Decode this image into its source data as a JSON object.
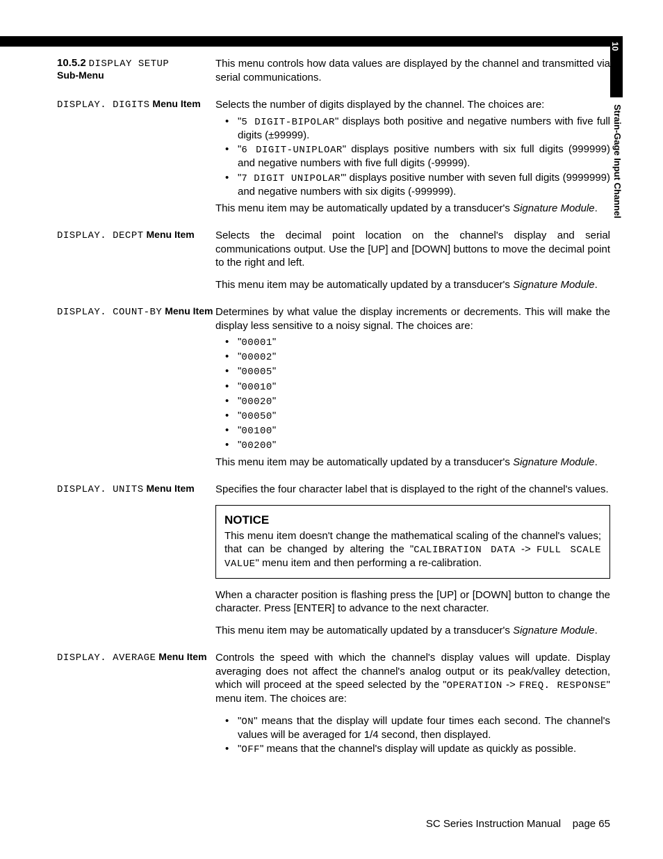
{
  "sidebar": {
    "chapter_num": "10",
    "chapter_title": "Strain-Gage Input Channel"
  },
  "section": {
    "num": "10.5.2",
    "title_lcd": "DISPLAY SETUP",
    "title_rest": "Sub-Menu",
    "intro": "This menu controls how data values are displayed by the channel and transmitted via serial communications."
  },
  "digits": {
    "label_prefix": "DISPLAY. DIGITS",
    "label_suffix": " Menu Item",
    "intro": "Selects the number of digits displayed by the channel. The choices are:",
    "b1a": "5 DIGIT-BIPOLAR",
    "b1b": "\" displays both positive and negative numbers with five full digits (±99999).",
    "b2a": "6 DIGIT-UNIPLOAR",
    "b2b": "\" displays positive numbers with six full digits (999999) and negative numbers with five full digits (-99999).",
    "b3a": "7 DIGIT UNIPOLAR",
    "b3b": "'\" displays positive number with seven full digits (9999999) and negative numbers with six digits (-999999).",
    "tail_a": "This menu item may be automatically updated by a transducer's ",
    "tail_i": "Signature Module",
    "tail_b": "."
  },
  "decpt": {
    "label_prefix": "DISPLAY. DECPT",
    "label_suffix": " Menu Item",
    "p1": "Selects the decimal point location on the channel's display and serial communications output.  Use the [UP] and [DOWN] buttons to move the decimal point to the right and left.",
    "tail_a": "This menu item may be automatically updated by a transducer's ",
    "tail_i": "Signature Module",
    "tail_b": "."
  },
  "countby": {
    "label_prefix": "DISPLAY. COUNT-BY",
    "label_suffix": " Menu Item",
    "intro": "Determines by what value the display increments or decrements.  This will make the display less sensitive to a noisy signal. The choices are:",
    "opts": [
      "00001",
      "00002",
      "00005",
      "00010",
      "00020",
      "00050",
      "00100",
      "00200"
    ],
    "tail_a": "This menu item may be automatically updated by a transducer's ",
    "tail_i": "Signature Module",
    "tail_b": "."
  },
  "units": {
    "label_prefix": "DISPLAY. UNITS",
    "label_suffix": " Menu Item",
    "p1": "Specifies the four character label that is displayed to the right of the channel's values.",
    "notice_title": "NOTICE",
    "notice_a": "This menu item doesn't change the mathematical scaling of the channel's values; that can be changed by altering the \"",
    "notice_lcd1": "CALIBRATION DATA",
    "notice_arrow": " -> ",
    "notice_lcd2": "FULL SCALE VALUE",
    "notice_b": "\" menu item and then performing a re-calibration.",
    "p2": "When a character position is flashing press the [UP] or [DOWN] button to change the character.  Press [ENTER] to advance to the next character.",
    "tail_a": "This menu item may be automatically updated by a transducer's ",
    "tail_i": "Signature Module",
    "tail_b": "."
  },
  "average": {
    "label_prefix": "DISPLAY. AVERAGE",
    "label_suffix": " Menu Item",
    "p1a": "Controls the speed with which the channel's display values will update.  Display averaging does not affect the channel's analog output or its peak/valley detection, which will proceed at the speed selected by the \"",
    "p1_lcd1": "OPERATION",
    "p1_arrow": " -> ",
    "p1_lcd2": "FREQ. RESPONSE",
    "p1b": "\" menu item.  The choices are:",
    "on_lcd": "ON",
    "on_text": "\" means that the display will update four times each second.  The channel's values will be averaged for 1/4 second, then displayed.",
    "off_lcd": "OFF",
    "off_text": "\" means that the channel's display will update as quickly as possible."
  },
  "footer": {
    "title": "SC Series Instruction Manual",
    "page": "page 65"
  }
}
